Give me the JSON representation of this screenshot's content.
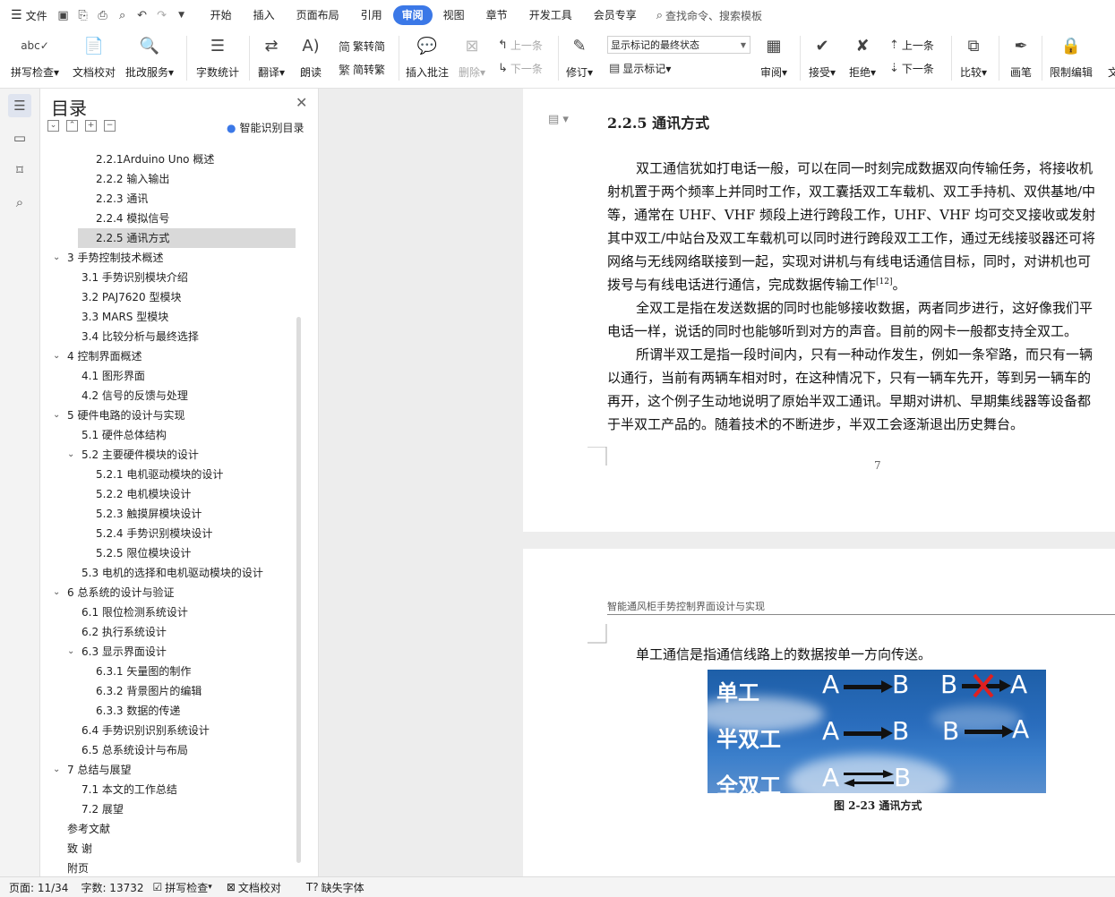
{
  "menubar": {
    "file_label": "文件",
    "tabs": [
      {
        "label": "开始",
        "active": false
      },
      {
        "label": "插入",
        "active": false
      },
      {
        "label": "页面布局",
        "active": false
      },
      {
        "label": "引用",
        "active": false
      },
      {
        "label": "审阅",
        "active": true
      },
      {
        "label": "视图",
        "active": false
      },
      {
        "label": "章节",
        "active": false
      },
      {
        "label": "开发工具",
        "active": false
      },
      {
        "label": "会员专享",
        "active": false
      }
    ],
    "search_placeholder": "查找命令、搜索模板"
  },
  "ribbon": {
    "spellcheck": "拼写检查",
    "doc_proof": "文档校对",
    "batch_service": "批改服务",
    "word_count": "字数统计",
    "translate": "翻译",
    "read_aloud": "朗读",
    "trad_to_simp": "繁转简",
    "simp_to_trad": "简转繁",
    "insert_comment": "插入批注",
    "delete": "删除",
    "prev_comment": "上一条",
    "next_comment": "下一条",
    "revise": "修订",
    "markup_state": "显示标记的最终状态",
    "show_markup": "显示标记",
    "review": "审阅",
    "accept": "接受",
    "reject": "拒绝",
    "prev_change": "上一条",
    "next_change": "下一条",
    "compare": "比较",
    "pen": "画笔",
    "restrict_edit": "限制编辑",
    "doc_truncated": "文"
  },
  "toc": {
    "title": "目录",
    "smart_label": "智能识别目录",
    "items": [
      {
        "text": "2.2.1Arduino Uno 概述",
        "level": 3,
        "selected": false,
        "chevron": ""
      },
      {
        "text": "2.2.2 输入输出",
        "level": 3,
        "selected": false,
        "chevron": ""
      },
      {
        "text": "2.2.3 通讯",
        "level": 3,
        "selected": false,
        "chevron": ""
      },
      {
        "text": "2.2.4 模拟信号",
        "level": 3,
        "selected": false,
        "chevron": ""
      },
      {
        "text": "2.2.5 通讯方式",
        "level": 3,
        "selected": true,
        "chevron": ""
      },
      {
        "text": "3  手势控制技术概述",
        "level": 1,
        "selected": false,
        "chevron": "v"
      },
      {
        "text": "3.1 手势识别模块介绍",
        "level": 2,
        "selected": false,
        "chevron": ""
      },
      {
        "text": "3.2 PAJ7620 型模块",
        "level": 2,
        "selected": false,
        "chevron": ""
      },
      {
        "text": "3.3 MARS 型模块",
        "level": 2,
        "selected": false,
        "chevron": ""
      },
      {
        "text": "3.4 比较分析与最终选择",
        "level": 2,
        "selected": false,
        "chevron": ""
      },
      {
        "text": "4  控制界面概述",
        "level": 1,
        "selected": false,
        "chevron": "v"
      },
      {
        "text": "4.1 图形界面",
        "level": 2,
        "selected": false,
        "chevron": ""
      },
      {
        "text": "4.2 信号的反馈与处理",
        "level": 2,
        "selected": false,
        "chevron": ""
      },
      {
        "text": "5  硬件电路的设计与实现",
        "level": 1,
        "selected": false,
        "chevron": "v"
      },
      {
        "text": "5.1 硬件总体结构",
        "level": 2,
        "selected": false,
        "chevron": ""
      },
      {
        "text": "5.2 主要硬件模块的设计",
        "level": 2,
        "selected": false,
        "chevron": "v"
      },
      {
        "text": "5.2.1 电机驱动模块的设计",
        "level": 3,
        "selected": false,
        "chevron": ""
      },
      {
        "text": "5.2.2 电机模块设计",
        "level": 3,
        "selected": false,
        "chevron": ""
      },
      {
        "text": "5.2.3 触摸屏模块设计",
        "level": 3,
        "selected": false,
        "chevron": ""
      },
      {
        "text": "5.2.4 手势识别模块设计",
        "level": 3,
        "selected": false,
        "chevron": ""
      },
      {
        "text": "5.2.5 限位模块设计",
        "level": 3,
        "selected": false,
        "chevron": ""
      },
      {
        "text": "5.3 电机的选择和电机驱动模块的设计",
        "level": 2,
        "selected": false,
        "chevron": ""
      },
      {
        "text": "6  总系统的设计与验证",
        "level": 1,
        "selected": false,
        "chevron": "v"
      },
      {
        "text": "6.1 限位检测系统设计",
        "level": 2,
        "selected": false,
        "chevron": ""
      },
      {
        "text": "6.2 执行系统设计",
        "level": 2,
        "selected": false,
        "chevron": ""
      },
      {
        "text": "6.3 显示界面设计",
        "level": 2,
        "selected": false,
        "chevron": "v"
      },
      {
        "text": "6.3.1 矢量图的制作",
        "level": 3,
        "selected": false,
        "chevron": ""
      },
      {
        "text": "6.3.2 背景图片的编辑",
        "level": 3,
        "selected": false,
        "chevron": ""
      },
      {
        "text": "6.3.3 数据的传递",
        "level": 3,
        "selected": false,
        "chevron": ""
      },
      {
        "text": "6.4 手势识别识别系统设计",
        "level": 2,
        "selected": false,
        "chevron": ""
      },
      {
        "text": "6.5 总系统设计与布局",
        "level": 2,
        "selected": false,
        "chevron": ""
      },
      {
        "text": "7  总结与展望",
        "level": 1,
        "selected": false,
        "chevron": "v"
      },
      {
        "text": "7.1 本文的工作总结",
        "level": 2,
        "selected": false,
        "chevron": ""
      },
      {
        "text": "7.2 展望",
        "level": 2,
        "selected": false,
        "chevron": ""
      },
      {
        "text": "参考文献",
        "level": 0,
        "selected": false,
        "chevron": ""
      },
      {
        "text": "致  谢",
        "level": 0,
        "selected": false,
        "chevron": ""
      },
      {
        "text": "附页",
        "level": 0,
        "selected": false,
        "chevron": ""
      }
    ]
  },
  "document": {
    "heading": "2.2.5 通讯方式",
    "page1_lines": [
      "双工通信犹如打电话一般，可以在同一时刻完成数据双向传输任务，将接收机",
      "射机置于两个频率上并同时工作，双工囊括双工车载机、双工手持机、双供基地/中",
      "等，通常在  UHF、VHF 频段上进行跨段工作，UHF、VHF 均可交叉接收或发射",
      "其中双工/中站台及双工车载机可以同时进行跨段双工工作，通过无线接驳器还可将",
      "网络与无线网络联接到一起，实现对讲机与有线电话通信目标，同时，对讲机也可",
      "拨号与有线电话进行通信，完成数据传输工作",
      "全双工是指在发送数据的同时也能够接收数据，两者同步进行，这好像我们平",
      "电话一样，说话的同时也能够听到对方的声音。目前的网卡一般都支持全双工。",
      "所谓半双工是指一段时间内，只有一种动作发生，例如一条窄路，而只有一辆",
      "以通行，当前有两辆车相对时，在这种情况下，只有一辆车先开，等到另一辆车的",
      "再开，这个例子生动地说明了原始半双工通讯。早期对讲机、早期集线器等设备都",
      "于半双工产品的。随着技术的不断进步，半双工会逐渐退出历史舞台。"
    ],
    "citation": "[12]",
    "citation_tail": "。",
    "page_number": "7",
    "page2_header": "智能通风柜手势控制界面设计与实现",
    "page2_line": "单工通信是指通信线路上的数据按单一方向传送。",
    "figure": {
      "row1_label": "单工",
      "row2_label": "半双工",
      "row3_label": "全双工",
      "a": "A",
      "b": "B",
      "caption": "图 2-23  通讯方式"
    }
  },
  "status": {
    "page": "页面: 11/34",
    "words": "字数: 13732",
    "spellcheck": "拼写检查",
    "doc_proof": "文档校对",
    "missing_font": "缺失字体"
  }
}
